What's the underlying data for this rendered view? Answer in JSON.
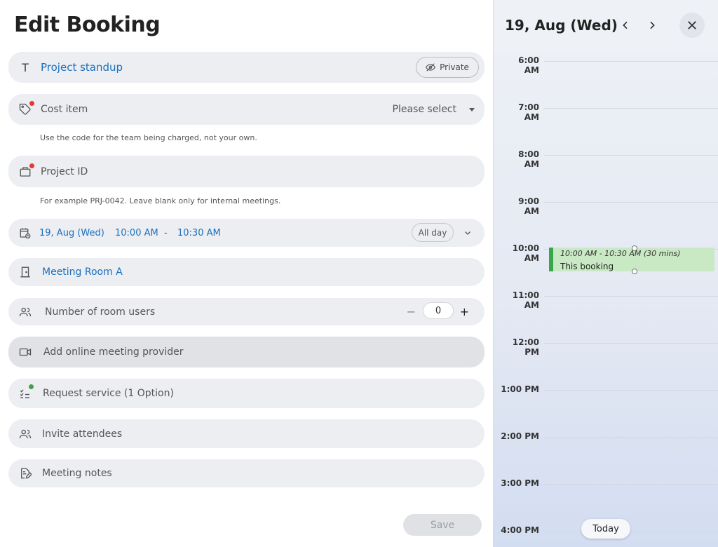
{
  "form": {
    "title": "Edit Booking",
    "booking_name": "Project standup",
    "private_label": "Private",
    "cost_item": {
      "label": "Cost item",
      "value": "Please select",
      "hint": "Use the code for the team being charged, not your own."
    },
    "project_id": {
      "label": "Project ID",
      "hint": "For example PRJ-0042. Leave blank only for internal meetings."
    },
    "datetime": {
      "date": "19, Aug (Wed)",
      "start": "10:00 AM",
      "separator": "-",
      "end": "10:30 AM",
      "all_day_label": "All day"
    },
    "room": "Meeting Room A",
    "room_users": {
      "label": "Number of room users",
      "minus": "−",
      "value": "0",
      "plus": "+"
    },
    "online_meeting": "Add online meeting provider",
    "request_service": "Request service (1 Option)",
    "invite": "Invite attendees",
    "notes": "Meeting notes",
    "save_label": "Save",
    "required_dot_color": "#e53935",
    "service_dot_color": "#43a047"
  },
  "calendar": {
    "date": "19, Aug (Wed)",
    "hours": [
      "6:00 AM",
      "7:00 AM",
      "8:00 AM",
      "9:00 AM",
      "10:00 AM",
      "11:00 AM",
      "12:00 PM",
      "1:00 PM",
      "2:00 PM",
      "3:00 PM",
      "4:00 PM"
    ],
    "event": {
      "time": "10:00 AM - 10:30 AM (30 mins)",
      "name": "This booking",
      "color": "#3aa64a"
    },
    "today_label": "Today"
  }
}
